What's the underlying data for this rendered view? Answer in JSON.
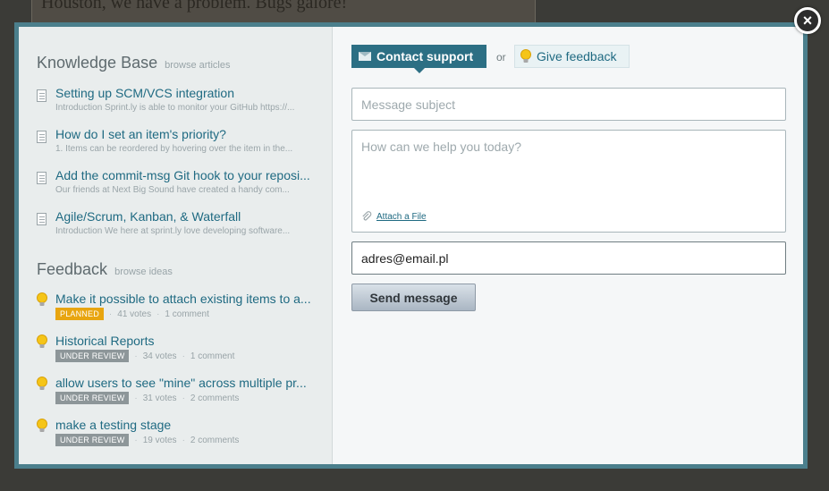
{
  "background": {
    "text": "Houston, we have a problem. Bugs galore!"
  },
  "knowledge_base": {
    "title": "Knowledge Base",
    "subtitle": "browse articles",
    "articles": [
      {
        "title": "Setting up SCM/VCS integration",
        "excerpt": "Introduction Sprint.ly is able to monitor your GitHub https://..."
      },
      {
        "title": "How do I set an item's priority?",
        "excerpt": "1. Items can be reordered by hovering over the item in the..."
      },
      {
        "title": "Add the commit-msg Git hook to your reposi...",
        "excerpt": "Our friends at Next Big Sound have created a handy com..."
      },
      {
        "title": "Agile/Scrum, Kanban, & Waterfall",
        "excerpt": "Introduction We here at sprint.ly love developing software..."
      }
    ]
  },
  "feedback": {
    "title": "Feedback",
    "subtitle": "browse ideas",
    "ideas": [
      {
        "title": "Make it possible to attach existing items to a...",
        "status": "PLANNED",
        "votes": "41 votes",
        "comments": "1 comment"
      },
      {
        "title": "Historical Reports",
        "status": "UNDER REVIEW",
        "votes": "34 votes",
        "comments": "1 comment"
      },
      {
        "title": "allow users to see \"mine\" across multiple pr...",
        "status": "UNDER REVIEW",
        "votes": "31 votes",
        "comments": "2 comments"
      },
      {
        "title": "make a testing stage",
        "status": "UNDER REVIEW",
        "votes": "19 votes",
        "comments": "2 comments"
      }
    ]
  },
  "contact": {
    "tab_contact": "Contact support",
    "or_label": "or",
    "tab_feedback": "Give feedback",
    "subject_placeholder": "Message subject",
    "message_placeholder": "How can we help you today?",
    "attach_label": "Attach a File",
    "email_value": "adres@email.pl",
    "send_label": "Send message"
  },
  "close": {
    "label": "×"
  },
  "colors": {
    "accent": "#2c6f84",
    "planned": "#e8a510",
    "review": "#8d9699",
    "link": "#1f6a82"
  }
}
